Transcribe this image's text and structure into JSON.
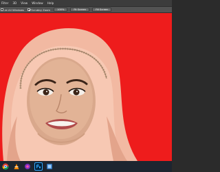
{
  "menubar": {
    "items": [
      "Filter",
      "3D",
      "View",
      "Window",
      "Help"
    ]
  },
  "options_bar": {
    "resize_windows_label": "ze All Windows",
    "scrubby_zoom_label": "Scrubby Zoom",
    "btn_100": "100%",
    "btn_fit": "Fit Screen",
    "btn_fill": "Fill Screen"
  },
  "canvas": {
    "background_color": "#ee1c1c"
  },
  "taskbar": {
    "icons": [
      "chrome-icon",
      "vlc-icon",
      "app-icon",
      "photoshop-icon",
      "app-icon-2"
    ]
  }
}
